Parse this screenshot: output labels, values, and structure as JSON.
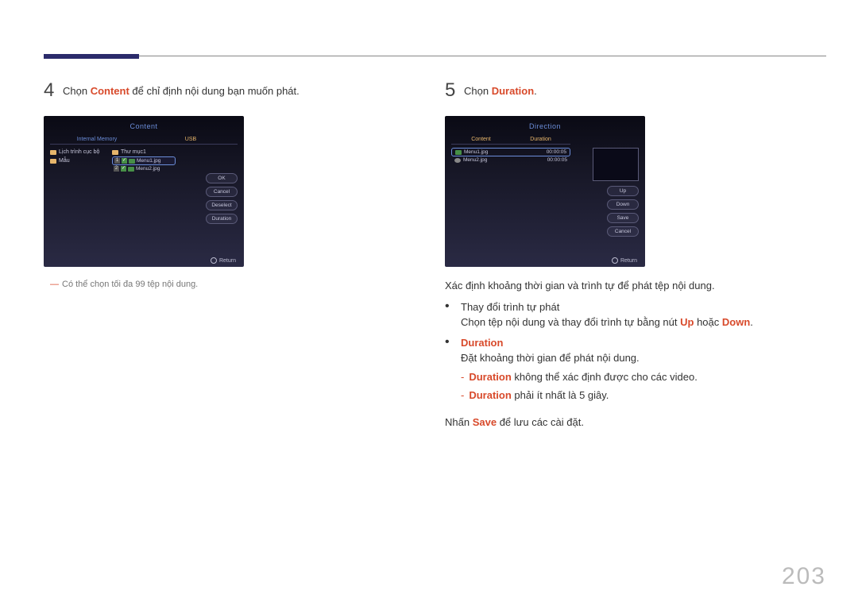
{
  "page_number": "203",
  "left": {
    "step_num": "4",
    "step_text_pre": "Chọn ",
    "step_kw": "Content",
    "step_text_post": " để chỉ định nội dung bạn muốn phát.",
    "screen": {
      "title": "Content",
      "tab1": "Internal Memory",
      "tab2": "USB",
      "left_items": [
        "Lịch trình cục bộ",
        "Mẫu"
      ],
      "mid_header": "Thư mục1",
      "file1_idx": "1",
      "file1": "Menu1.jpg",
      "file2_idx": "2",
      "file2": "Menu2.jpg",
      "btn_ok": "OK",
      "btn_cancel": "Cancel",
      "btn_deselect": "Deselect",
      "btn_duration": "Duration",
      "return": "Return"
    },
    "note": "Có thể chọn tối đa 99 tệp nội dung."
  },
  "right": {
    "step_num": "5",
    "step_text_pre": "Chọn ",
    "step_kw": "Duration",
    "step_text_post": ".",
    "screen": {
      "title": "Direction",
      "tab1": "Content",
      "tab2": "Duration",
      "file1": "Menu1.jpg",
      "dur1": "00:00:05",
      "file2": "Menu2.jpg",
      "dur2": "00:00:05",
      "btn_up": "Up",
      "btn_down": "Down",
      "btn_save": "Save",
      "btn_cancel": "Cancel",
      "return": "Return"
    },
    "p1": "Xác định khoảng thời gian và trình tự để phát tệp nội dung.",
    "bullet1_title": "Thay đổi trình tự phát",
    "bullet1_body_pre": "Chọn tệp nội dung và thay đổi trình tự bằng nút ",
    "bullet1_up": "Up",
    "bullet1_or": " hoặc ",
    "bullet1_down": "Down",
    "bullet1_end": ".",
    "bullet2_title": "Duration",
    "bullet2_body": "Đặt khoảng thời gian để phát nội dung.",
    "dash1_kw": "Duration",
    "dash1_rest": " không thể xác định được cho các video.",
    "dash2_kw": "Duration",
    "dash2_rest": " phải ít nhất là 5 giây.",
    "p2_pre": "Nhấn ",
    "p2_kw": "Save",
    "p2_post": " để lưu các cài đặt."
  }
}
